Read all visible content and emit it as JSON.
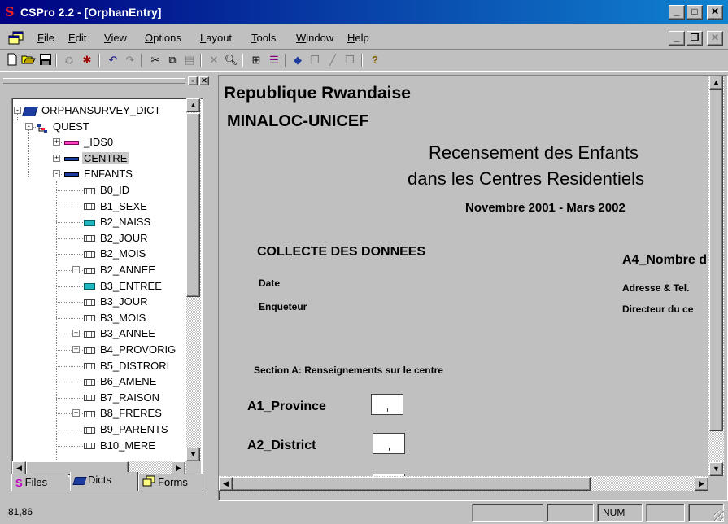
{
  "window": {
    "title": "CSPro 2.2 - [OrphanEntry]",
    "app_icon": "S"
  },
  "menu": {
    "items": [
      {
        "label": "File",
        "mn": "F",
        "rest": "ile"
      },
      {
        "label": "Edit",
        "mn": "E",
        "rest": "dit"
      },
      {
        "label": "View",
        "mn": "V",
        "rest": "iew"
      },
      {
        "label": "Options",
        "mn": "O",
        "rest": "ptions"
      },
      {
        "label": "Layout",
        "mn": "L",
        "rest": "ayout"
      },
      {
        "label": "Tools",
        "mn": "T",
        "rest": "ools"
      },
      {
        "label": "Window",
        "mn": "W",
        "rest": "indow"
      },
      {
        "label": "Help",
        "mn": "H",
        "rest": "elp"
      }
    ]
  },
  "toolbar": {
    "icons": [
      "new-icon",
      "open-icon",
      "save-icon",
      "generate-icon",
      "run-icon",
      "undo-icon",
      "redo-icon",
      "cut-icon",
      "copy-icon",
      "paste-icon",
      "delete-icon",
      "find-icon",
      "grid-icon",
      "align-icon",
      "dictionary-icon",
      "forms-icon",
      "line-icon",
      "box-icon",
      "help-icon"
    ]
  },
  "tree": {
    "items": [
      {
        "label": "ORPHANSURVEY_DICT",
        "level": 0,
        "icon": "dictionary-book-icon",
        "expander": "-"
      },
      {
        "label": "QUEST",
        "level": 1,
        "icon": "level-icon",
        "expander": "-"
      },
      {
        "label": "_IDS0",
        "level": 2,
        "icon": "id-record-icon",
        "expander": "+"
      },
      {
        "label": "CENTRE",
        "level": 2,
        "icon": "record-icon",
        "expander": "+",
        "selected": true
      },
      {
        "label": "ENFANTS",
        "level": 2,
        "icon": "record-icon",
        "expander": "-"
      },
      {
        "label": "B0_ID",
        "level": 3,
        "icon": "item-icon"
      },
      {
        "label": "B1_SEXE",
        "level": 3,
        "icon": "item-icon"
      },
      {
        "label": "B2_NAISS",
        "level": 3,
        "icon": "subitem-icon"
      },
      {
        "label": "B2_JOUR",
        "level": 3,
        "icon": "item-icon"
      },
      {
        "label": "B2_MOIS",
        "level": 3,
        "icon": "item-icon"
      },
      {
        "label": "B2_ANNEE",
        "level": 3,
        "icon": "item-icon",
        "expander": "+"
      },
      {
        "label": "B3_ENTREE",
        "level": 3,
        "icon": "subitem-icon"
      },
      {
        "label": "B3_JOUR",
        "level": 3,
        "icon": "item-icon"
      },
      {
        "label": "B3_MOIS",
        "level": 3,
        "icon": "item-icon"
      },
      {
        "label": "B3_ANNEE",
        "level": 3,
        "icon": "item-icon",
        "expander": "+"
      },
      {
        "label": "B4_PROVORIG",
        "level": 3,
        "icon": "item-icon",
        "expander": "+"
      },
      {
        "label": "B5_DISTRORI",
        "level": 3,
        "icon": "item-icon"
      },
      {
        "label": "B6_AMENE",
        "level": 3,
        "icon": "item-icon"
      },
      {
        "label": "B7_RAISON",
        "level": 3,
        "icon": "item-icon"
      },
      {
        "label": "B8_FRERES",
        "level": 3,
        "icon": "item-icon",
        "expander": "+"
      },
      {
        "label": "B9_PARENTS",
        "level": 3,
        "icon": "item-icon"
      },
      {
        "label": "B10_MERE",
        "level": 3,
        "icon": "item-icon"
      }
    ]
  },
  "tabs": [
    {
      "label": "Files",
      "icon": "files-icon"
    },
    {
      "label": "Dicts",
      "icon": "dicts-icon",
      "active": true
    },
    {
      "label": "Forms",
      "icon": "forms-icon"
    }
  ],
  "form": {
    "country": "Republique Rwandaise",
    "org": "MINALOC-UNICEF",
    "heading1": "Recensement des Enfants",
    "heading2": "dans les Centres Residentiels",
    "period": "Novembre 2001 - Mars 2002",
    "collecte": "COLLECTE DES DONNEES",
    "date_label": "Date",
    "enqueteur_label": "Enqueteur",
    "a4_label": "A4_Nombre d",
    "adresse_label": "Adresse & Tel.",
    "directeur_label": "Directeur du ce",
    "section_a": "Section A:  Renseignements sur le centre",
    "a1_label": "A1_Province",
    "a2_label": "A2_District"
  },
  "status": {
    "position": "81,86",
    "num": "NUM"
  }
}
